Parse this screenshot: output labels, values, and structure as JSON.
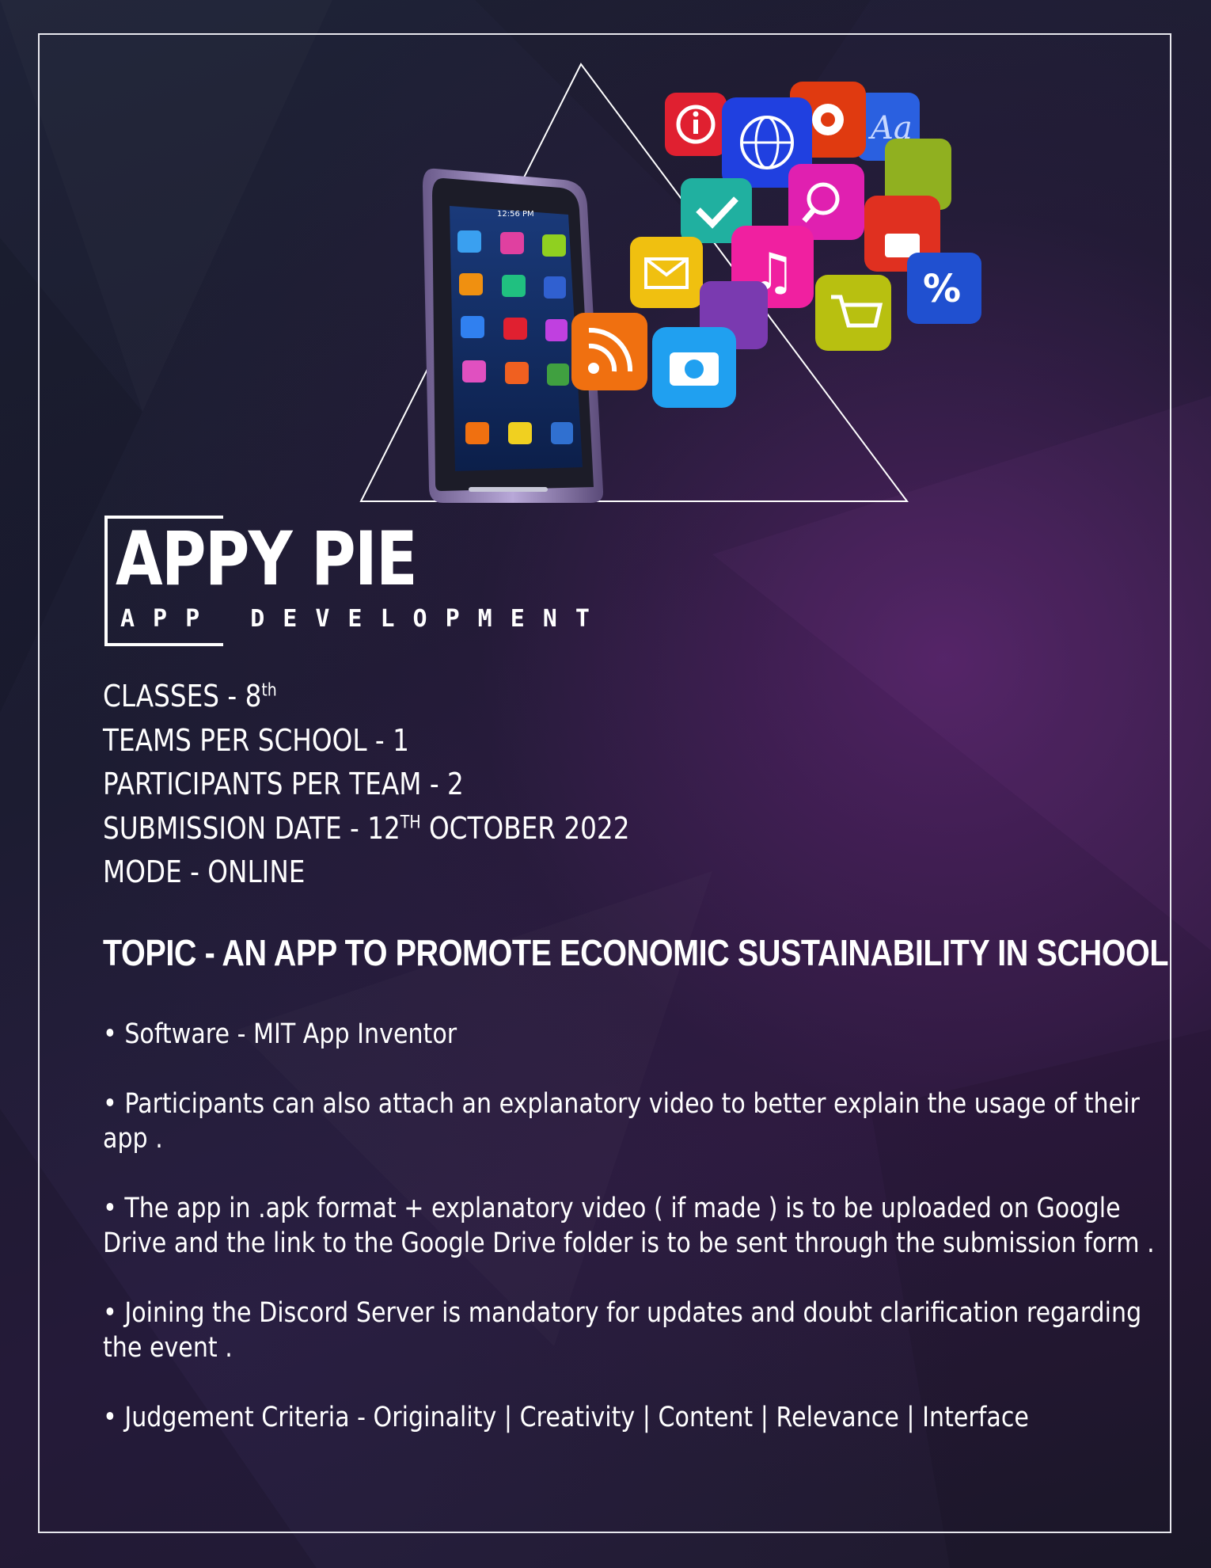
{
  "brand": {
    "title": "APPY PIE",
    "subtitle": "APP DEVELOPMENT"
  },
  "phone": {
    "time": "12:56 PM",
    "apps": [
      "Chat",
      "Music",
      "Store",
      "News",
      "Organizer",
      "Internet",
      "Business",
      "Help",
      "Security",
      "Search",
      "Certificates",
      "Downloads",
      "Settings",
      "Messages",
      "Camera"
    ]
  },
  "details": [
    {
      "label": "CLASSES - 8",
      "sup": "th",
      "suffix": ""
    },
    {
      "label": "TEAMS PER SCHOOL - 1",
      "sup": "",
      "suffix": ""
    },
    {
      "label": "PARTICIPANTS PER TEAM - 2",
      "sup": "",
      "suffix": ""
    },
    {
      "label": "SUBMISSION DATE - 12",
      "sup": "TH",
      "suffix": " OCTOBER 2022"
    },
    {
      "label": "MODE - ONLINE",
      "sup": "",
      "suffix": ""
    }
  ],
  "topic": "TOPIC - AN APP TO PROMOTE ECONOMIC SUSTAINABILITY IN SCHOOL",
  "points": [
    "• Software - MIT App Inventor",
    "• Participants can also attach an explanatory video to better explain the usage of their app .",
    "• The app in .apk format + explanatory video ( if made ) is to be uploaded on Google Drive and the link to the Google Drive folder is to be sent through the submission form .",
    "• Joining the Discord Server is mandatory for updates and doubt clarification regarding the event .",
    "• Judgement Criteria - Originality | Creativity | Content | Relevance | Interface"
  ],
  "colors": {
    "background": "#1c1c2e",
    "frame": "#e8e8ee",
    "text": "#ffffff"
  }
}
